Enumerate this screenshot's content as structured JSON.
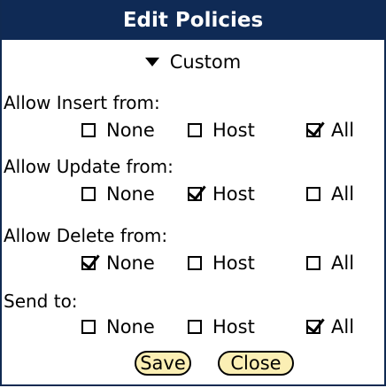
{
  "dialog": {
    "title": "Edit Policies"
  },
  "preset": {
    "selected": "Custom"
  },
  "sections": [
    {
      "label": "Allow Insert from:",
      "options": [
        {
          "label": "None",
          "checked": false
        },
        {
          "label": "Host",
          "checked": false
        },
        {
          "label": "All",
          "checked": true
        }
      ]
    },
    {
      "label": "Allow Update from:",
      "options": [
        {
          "label": "None",
          "checked": false
        },
        {
          "label": "Host",
          "checked": true
        },
        {
          "label": "All",
          "checked": false
        }
      ]
    },
    {
      "label": "Allow Delete from:",
      "options": [
        {
          "label": "None",
          "checked": true
        },
        {
          "label": "Host",
          "checked": false
        },
        {
          "label": "All",
          "checked": false
        }
      ]
    },
    {
      "label": "Send to:",
      "options": [
        {
          "label": "None",
          "checked": false
        },
        {
          "label": "Host",
          "checked": false
        },
        {
          "label": "All",
          "checked": true
        }
      ]
    }
  ],
  "buttons": {
    "save": "Save",
    "close": "Close"
  }
}
